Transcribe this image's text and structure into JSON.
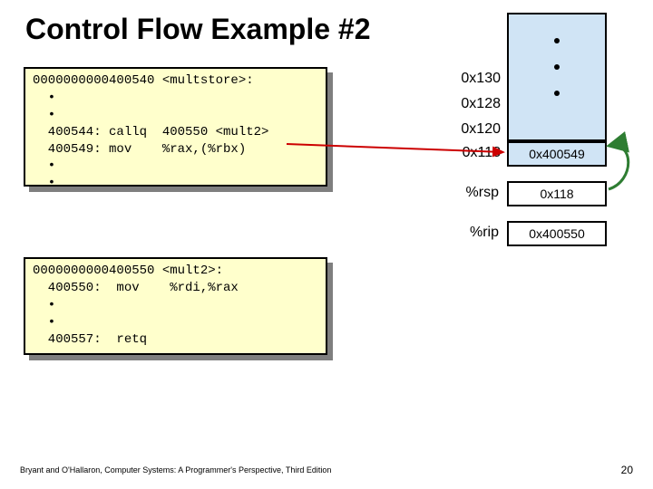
{
  "title": "Control Flow Example #2",
  "code1": "0000000000400540 <multstore>:\n  •\n  •\n  400544: callq  400550 <mult2>\n  400549: mov    %rax,(%rbx)\n  •\n  •",
  "code2": "0000000000400550 <mult2>:\n  400550:  mov    %rdi,%rax\n  •\n  •\n  400557:  retq",
  "stack": {
    "addr130": "0x130",
    "addr128": "0x128",
    "addr120": "0x120",
    "addr118": "0x118",
    "val118": "0x400549",
    "rspLabel": "%rsp",
    "rspVal": "0x118",
    "ripLabel": "%rip",
    "ripVal": "0x400550"
  },
  "footer": "Bryant and O'Hallaron, Computer Systems: A Programmer's Perspective, Third Edition",
  "page": "20"
}
